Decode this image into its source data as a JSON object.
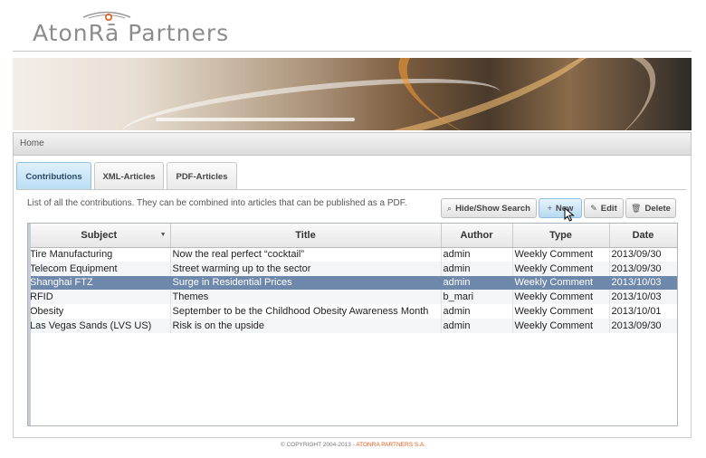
{
  "brand": {
    "logo_text": "AtonRā Partners",
    "accent": "#e05a1a"
  },
  "breadcrumb": {
    "label": "Home"
  },
  "tabs": [
    {
      "label": "Contributions",
      "active": true
    },
    {
      "label": "XML-Articles",
      "active": false
    },
    {
      "label": "PDF-Articles",
      "active": false
    }
  ],
  "description": "List of all the contributions. They can be combined into articles that can be published as a PDF.",
  "toolbar": {
    "hide_show_search": {
      "label": "Hide/Show Search",
      "icon": "search-icon"
    },
    "new": {
      "label": "New",
      "icon": "plus-icon"
    },
    "edit": {
      "label": "Edit",
      "icon": "pencil-icon"
    },
    "delete": {
      "label": "Delete",
      "icon": "trash-icon"
    }
  },
  "grid": {
    "columns": [
      "Subject",
      "Title",
      "Author",
      "Type",
      "Date"
    ],
    "sort_column": "Subject",
    "selected_row": 2,
    "selection_color": "#6e88ab",
    "rows": [
      {
        "subject": "Tire Manufacturing",
        "title": "Now the real perfect “cocktail”",
        "author": "admin",
        "type": "Weekly Comment",
        "date": "2013/09/30"
      },
      {
        "subject": "Telecom Equipment",
        "title": "Street warming up to the sector",
        "author": "admin",
        "type": "Weekly Comment",
        "date": "2013/09/30"
      },
      {
        "subject": "Shanghai FTZ",
        "title": "Surge in Residential Prices",
        "author": "admin",
        "type": "Weekly Comment",
        "date": "2013/10/03"
      },
      {
        "subject": "RFID",
        "title": "Themes",
        "author": "b_mari",
        "type": "Weekly Comment",
        "date": "2013/10/03"
      },
      {
        "subject": "Obesity",
        "title": "September to be the Childhood Obesity Awareness Month",
        "author": "admin",
        "type": "Weekly Comment",
        "date": "2013/10/01"
      },
      {
        "subject": "Las Vegas Sands (LVS US)",
        "title": "Risk is on the upside",
        "author": "admin",
        "type": "Weekly Comment",
        "date": "2013/09/30"
      }
    ]
  },
  "footer": {
    "copyright": "© COPYRIGHT 2004-2013 - ",
    "company": "ATONRA PARTNERS S.A."
  }
}
